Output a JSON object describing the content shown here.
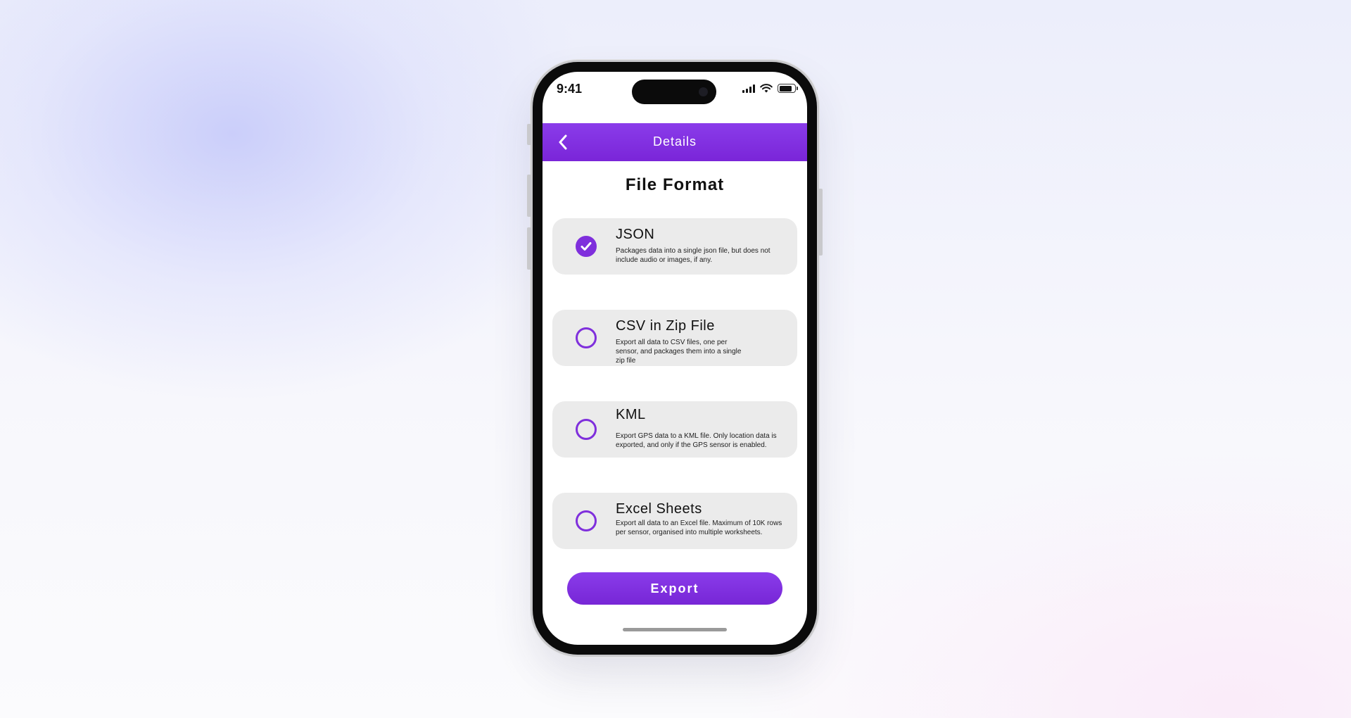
{
  "status_bar": {
    "time": "9:41"
  },
  "nav": {
    "title": "Details"
  },
  "page": {
    "title": "File Format"
  },
  "options": [
    {
      "title": "JSON",
      "description": "Packages data into a single json file, but does not include audio or images, if any.",
      "selected": true
    },
    {
      "title": "CSV in Zip File",
      "description": "Export all data to CSV files, one per sensor, and packages them into a single zip file",
      "selected": false
    },
    {
      "title": "KML",
      "description": "Export GPS data to a KML file. Only location data is exported, and only if the GPS sensor is enabled.",
      "selected": false
    },
    {
      "title": "Excel Sheets",
      "description": "Export all data to an Excel file. Maximum of 10K rows per sensor, organised into multiple worksheets.",
      "selected": false
    }
  ],
  "actions": {
    "export_label": "Export"
  },
  "colors": {
    "accent": "#7f2fdc",
    "card_background": "#ebebeb"
  },
  "icons": {
    "back": "chevron-left-icon",
    "selected": "checkmark-icon"
  }
}
